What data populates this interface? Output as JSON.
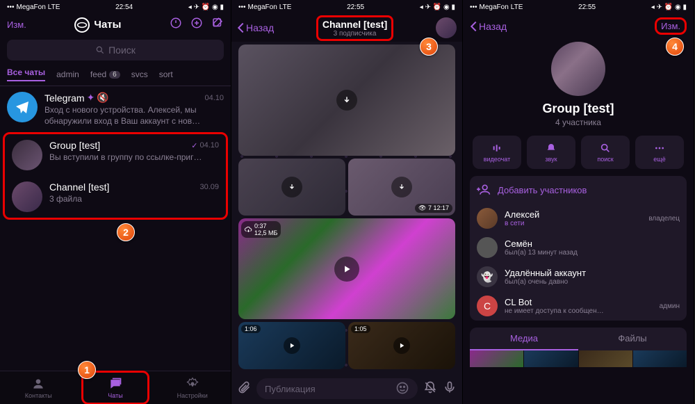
{
  "status": {
    "carrier": "MegaFon",
    "net": "LTE",
    "t1": "22:54",
    "t2": "22:55",
    "t3": "22:55",
    "icons": "◂ ✈ ⏰ ◉ ▮"
  },
  "s1": {
    "edit": "Изм.",
    "title": "Чаты",
    "search": "Поиск",
    "tabs": {
      "all": "Все чаты",
      "admin": "admin",
      "feed": "feed",
      "feed_badge": "6",
      "svcs": "svcs",
      "sort": "sort"
    },
    "chats": {
      "tg": {
        "name": "Telegram",
        "msg": "Вход с нового устройства. Алексей, мы обнаружили вход в Ваш аккаунт с нов…",
        "date": "04.10"
      },
      "grp": {
        "name": "Group [test]",
        "msg": "Вы вступили в группу по ссылке-приг…",
        "date": "04.10"
      },
      "ch": {
        "name": "Channel [test]",
        "msg": "3 файла",
        "date": "30.09"
      }
    },
    "nav": {
      "contacts": "Контакты",
      "chats": "Чаты",
      "settings": "Настройки"
    }
  },
  "s2": {
    "back": "Назад",
    "title": "Channel [test]",
    "sub": "3 подписчика",
    "dur1": "0:37",
    "size1": "12,5 МБ",
    "dur2": "1:06",
    "dur3": "1:05",
    "views": "7 12:17",
    "compose": "Публикация"
  },
  "s3": {
    "back": "Назад",
    "edit": "Изм.",
    "name": "Group [test]",
    "sub": "4 участника",
    "actions": {
      "video": "видеочат",
      "sound": "звук",
      "search": "поиск",
      "more": "ещё"
    },
    "add": "Добавить участников",
    "members": {
      "m1": {
        "name": "Алексей",
        "status": "в сети",
        "role": "владелец"
      },
      "m2": {
        "name": "Семён",
        "status": "был(а) 13 минут назад"
      },
      "m3": {
        "name": "Удалённый аккаунт",
        "status": "был(а) очень давно"
      },
      "m4": {
        "name": "CL Bot",
        "status": "не имеет доступа к сообщен…",
        "role": "админ"
      }
    },
    "tabs": {
      "media": "Медиа",
      "files": "Файлы"
    }
  },
  "anno": {
    "a1": "1",
    "a2": "2",
    "a3": "3",
    "a4": "4"
  }
}
